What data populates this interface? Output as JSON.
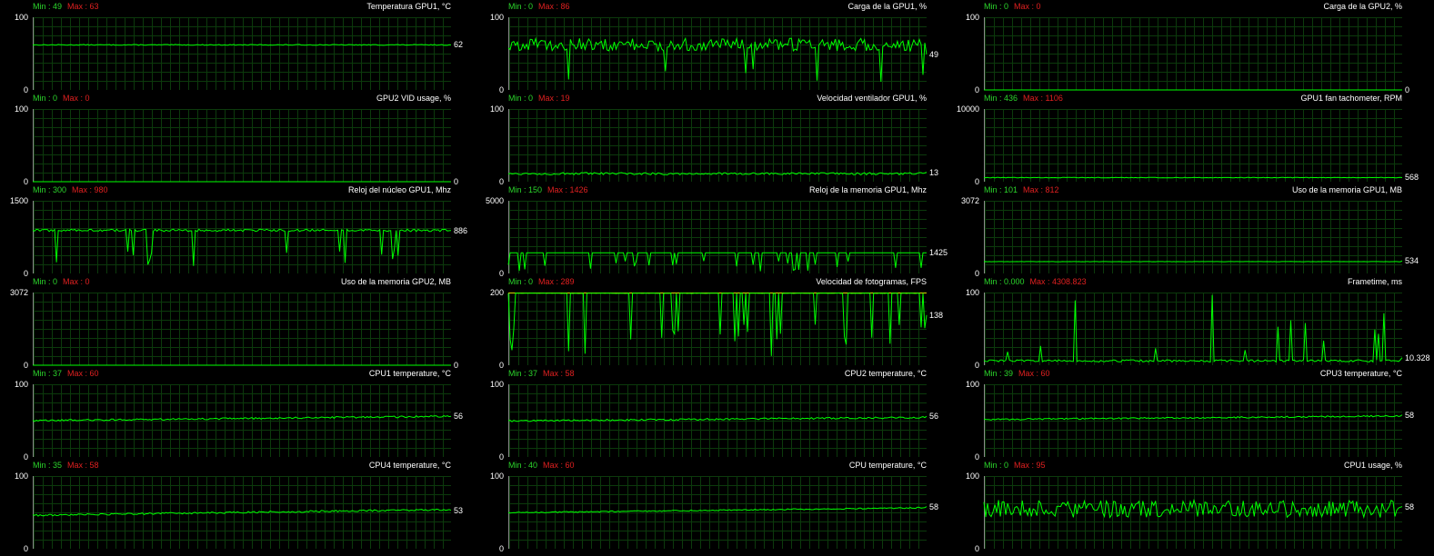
{
  "colors": {
    "background": "#000000",
    "grid": "#0c3a0c",
    "trace": "#00ff00",
    "trace_secondary": "#d7d700",
    "min_text": "#2bd52b",
    "max_text": "#e02020"
  },
  "panels": [
    {
      "title": "Temperatura GPU1, °C",
      "min_label": "Min : 49",
      "max_label": "Max : 63",
      "y_top": "100",
      "y_bottom": "0",
      "ymax": 100,
      "current": "62",
      "baseline": 62,
      "noise": 0.6,
      "dips": 0,
      "spikes": 0
    },
    {
      "title": "Carga de la GPU1, %",
      "min_label": "Min : 0",
      "max_label": "Max : 86",
      "y_top": "100",
      "y_bottom": "0",
      "ymax": 100,
      "current": "49",
      "baseline": 62,
      "noise": 9,
      "dips": 1,
      "spikes": 0
    },
    {
      "title": "Carga de la GPU2, %",
      "min_label": "Min : 0",
      "max_label": "Max : 0",
      "y_top": "100",
      "y_bottom": "0",
      "ymax": 100,
      "current": "0",
      "baseline": 0,
      "noise": 0,
      "dips": 0,
      "spikes": 0
    },
    {
      "title": "GPU2 VID usage, %",
      "min_label": "Min : 0",
      "max_label": "Max : 0",
      "y_top": "100",
      "y_bottom": "0",
      "ymax": 100,
      "current": "0",
      "baseline": 0,
      "noise": 0,
      "dips": 0,
      "spikes": 0
    },
    {
      "title": "Velocidad ventilador GPU1, %",
      "min_label": "Min : 0",
      "max_label": "Max : 19",
      "y_top": "100",
      "y_bottom": "0",
      "ymax": 100,
      "current": "13",
      "baseline": 11,
      "noise": 1.6,
      "dips": 0,
      "spikes": 0
    },
    {
      "title": "GPU1 fan tachometer, RPM",
      "min_label": "Min : 436",
      "max_label": "Max : 1106",
      "y_top": "10000",
      "y_bottom": "0",
      "ymax": 10000,
      "current": "568",
      "baseline": 560,
      "noise": 40,
      "dips": 0,
      "spikes": 0
    },
    {
      "title": "Reloj del núcleo GPU1, Mhz",
      "min_label": "Min : 300",
      "max_label": "Max : 980",
      "y_top": "1500",
      "y_bottom": "0",
      "ymax": 1500,
      "current": "886",
      "baseline": 890,
      "noise": 25,
      "dips": 2,
      "spikes": 0
    },
    {
      "title": "Reloj de la memoria GPU1, Mhz",
      "min_label": "Min : 150",
      "max_label": "Max : 1426",
      "y_top": "5000",
      "y_bottom": "0",
      "ymax": 5000,
      "current": "1425",
      "baseline": 1425,
      "noise": 0,
      "dips": 3,
      "spikes": 0
    },
    {
      "title": "Uso de la memoria GPU1, MB",
      "min_label": "Min : 101",
      "max_label": "Max : 812",
      "y_top": "3072",
      "y_bottom": "0",
      "ymax": 3072,
      "current": "534",
      "baseline": 500,
      "noise": 5,
      "dips": 0,
      "spikes": 0
    },
    {
      "title": "Uso de la memoria GPU2, MB",
      "min_label": "Min : 0",
      "max_label": "Max : 0",
      "y_top": "3072",
      "y_bottom": "0",
      "ymax": 3072,
      "current": "0",
      "baseline": 0,
      "noise": 0,
      "dips": 0,
      "spikes": 0
    },
    {
      "title": "Velocidad de fotogramas, FPS",
      "min_label": "Min : 0",
      "max_label": "Max : 289",
      "y_top": "200",
      "y_bottom": "0",
      "ymax": 200,
      "current": "138",
      "baseline": 198,
      "noise": 0.5,
      "dips": 3,
      "spikes": 0,
      "cap": 200
    },
    {
      "title": "Frametime, ms",
      "min_label": "Min : 0.000",
      "max_label": "Max : 4308.823",
      "y_top": "100",
      "y_bottom": "0",
      "ymax": 100,
      "current": "10.328",
      "baseline": 6,
      "noise": 1.5,
      "dips": 0,
      "spikes": 1
    },
    {
      "title": "CPU1 temperature, °C",
      "min_label": "Min : 37",
      "max_label": "Max : 60",
      "y_top": "100",
      "y_bottom": "0",
      "ymax": 100,
      "current": "56",
      "baseline": 53,
      "noise": 1.2,
      "dips": 0,
      "spikes": 0,
      "ramp": 6
    },
    {
      "title": "CPU2 temperature, °C",
      "min_label": "Min : 37",
      "max_label": "Max : 58",
      "y_top": "100",
      "y_bottom": "0",
      "ymax": 100,
      "current": "56",
      "baseline": 52,
      "noise": 1.2,
      "dips": 0,
      "spikes": 0,
      "ramp": 5
    },
    {
      "title": "CPU3 temperature, °C",
      "min_label": "Min : 39",
      "max_label": "Max : 60",
      "y_top": "100",
      "y_bottom": "0",
      "ymax": 100,
      "current": "58",
      "baseline": 54,
      "noise": 1.0,
      "dips": 0,
      "spikes": 0,
      "ramp": 5
    },
    {
      "title": "CPU4 temperature, °C",
      "min_label": "Min : 35",
      "max_label": "Max : 58",
      "y_top": "100",
      "y_bottom": "0",
      "ymax": 100,
      "current": "53",
      "baseline": 50,
      "noise": 1.2,
      "dips": 0,
      "spikes": 0,
      "ramp": 8
    },
    {
      "title": "CPU temperature, °C",
      "min_label": "Min : 40",
      "max_label": "Max : 60",
      "y_top": "100",
      "y_bottom": "0",
      "ymax": 100,
      "current": "58",
      "baseline": 53,
      "noise": 0.8,
      "dips": 0,
      "spikes": 0,
      "ramp": 7
    },
    {
      "title": "CPU1 usage, %",
      "min_label": "Min : 0",
      "max_label": "Max : 95",
      "y_top": "100",
      "y_bottom": "0",
      "ymax": 100,
      "current": "58",
      "baseline": 55,
      "noise": 12,
      "dips": 0,
      "spikes": 0
    }
  ]
}
